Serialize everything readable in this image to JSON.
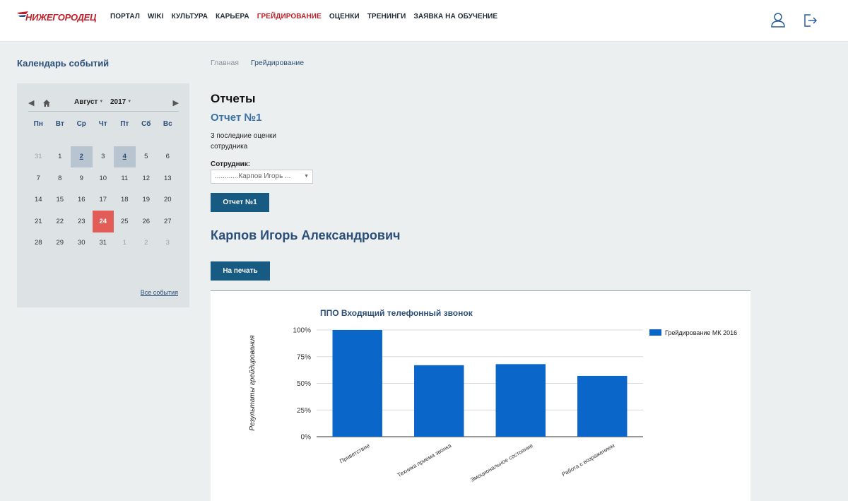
{
  "header": {
    "logo_text": "Нижегородец",
    "nav": [
      {
        "label": "ПОРТАЛ",
        "active": false
      },
      {
        "label": "WIKI",
        "active": false
      },
      {
        "label": "КУЛЬТУРА",
        "active": false
      },
      {
        "label": "КАРЬЕРА",
        "active": false
      },
      {
        "label": "ГРЕЙДИРОВАНИЕ",
        "active": true
      },
      {
        "label": "ОЦЕНКИ",
        "active": false
      },
      {
        "label": "ТРЕНИНГИ",
        "active": false
      },
      {
        "label": "ЗАЯВКА НА ОБУЧЕНИЕ",
        "active": false
      }
    ],
    "icons": [
      "user-icon",
      "logout-icon"
    ],
    "accent_color": "#c0202a"
  },
  "calendar": {
    "title": "Календарь событий",
    "month": "Август",
    "year": "2017",
    "weekdays": [
      "Пн",
      "Вт",
      "Ср",
      "Чт",
      "Пт",
      "Сб",
      "Вс"
    ],
    "days": [
      {
        "d": "31",
        "muted": true
      },
      {
        "d": "1"
      },
      {
        "d": "2",
        "event": true
      },
      {
        "d": "3"
      },
      {
        "d": "4",
        "event": true
      },
      {
        "d": "5"
      },
      {
        "d": "6"
      },
      {
        "d": "7"
      },
      {
        "d": "8"
      },
      {
        "d": "9"
      },
      {
        "d": "10"
      },
      {
        "d": "11"
      },
      {
        "d": "12"
      },
      {
        "d": "13"
      },
      {
        "d": "14"
      },
      {
        "d": "15"
      },
      {
        "d": "16"
      },
      {
        "d": "17"
      },
      {
        "d": "18"
      },
      {
        "d": "19"
      },
      {
        "d": "20"
      },
      {
        "d": "21"
      },
      {
        "d": "22"
      },
      {
        "d": "23"
      },
      {
        "d": "24",
        "today": true
      },
      {
        "d": "25"
      },
      {
        "d": "26"
      },
      {
        "d": "27"
      },
      {
        "d": "28"
      },
      {
        "d": "29"
      },
      {
        "d": "30"
      },
      {
        "d": "31"
      },
      {
        "d": "1",
        "muted": true
      },
      {
        "d": "2",
        "muted": true
      },
      {
        "d": "3",
        "muted": true
      }
    ],
    "all_events_link": "Все события",
    "today_color": "#e35d58"
  },
  "breadcrumb": [
    "Главная",
    "Грейдирование"
  ],
  "main": {
    "title": "Отчеты",
    "report_title": "Отчет №1",
    "description": "3 последние оценки сотрудника",
    "employee_label": "Сотрудник:",
    "employee_select_value": "............Карпов Игорь ...",
    "report_button": "Отчет №1",
    "employee_name": "Карпов Игорь Александрович",
    "print_button": "На печать"
  },
  "chart_data": {
    "type": "bar",
    "title": "ППО Входящий телефонный звонок",
    "ylabel": "Результаты грейдирования",
    "xlabel": "",
    "categories": [
      "Приветствие",
      "Техника приема звонка",
      "Эмоциональное состояние",
      "Работа с возражением"
    ],
    "series": [
      {
        "name": "Грейдирование МК 2016",
        "values": [
          100,
          67,
          68,
          57
        ],
        "color": "#0b66c9"
      }
    ],
    "ylim": [
      0,
      100
    ],
    "yticks": [
      "0%",
      "25%",
      "50%",
      "75%",
      "100%"
    ],
    "grid": true,
    "legend": "right"
  }
}
